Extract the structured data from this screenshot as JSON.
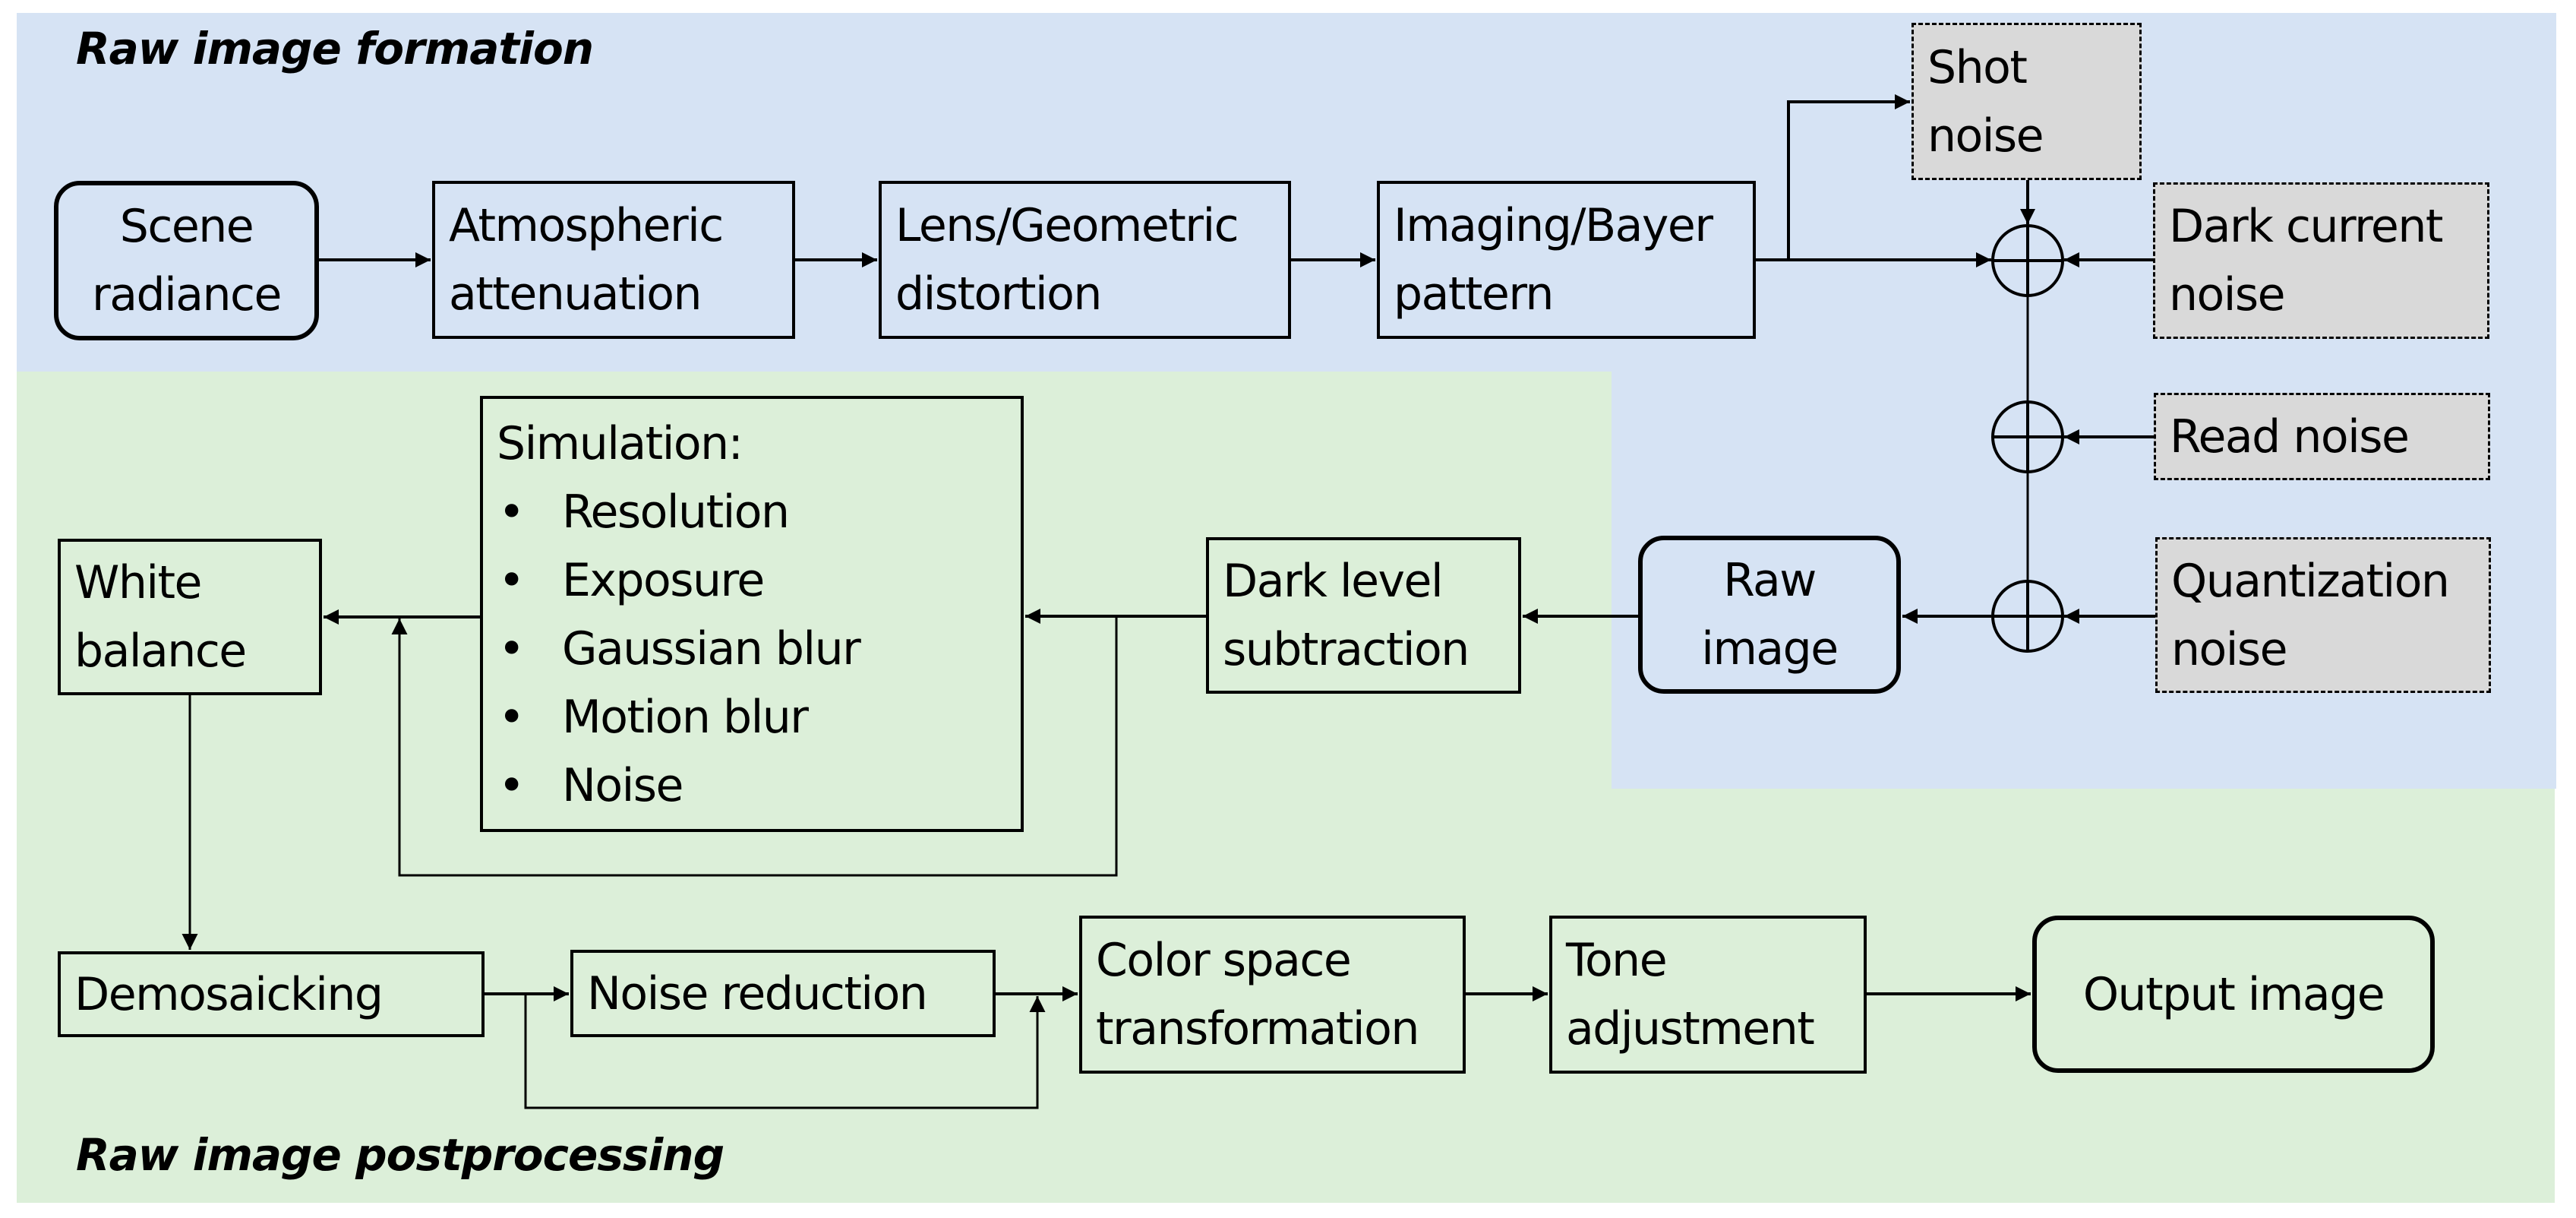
{
  "sections": {
    "formation_title": "Raw image formation",
    "postprocessing_title": "Raw image postprocessing"
  },
  "colors": {
    "formation_panel": "#d6e3f4",
    "postprocessing_panel": "#dcefd9",
    "noise_box": "#d9d9d9",
    "stroke": "#000000"
  },
  "formation": {
    "scene_radiance": [
      "Scene",
      "radiance"
    ],
    "atmospheric": [
      "Atmospheric",
      "attenuation"
    ],
    "lens": [
      "Lens/Geometric",
      "distortion"
    ],
    "imaging": [
      "Imaging/Bayer",
      "pattern"
    ],
    "shot_noise": [
      "Shot",
      "noise"
    ],
    "dark_current_noise": [
      "Dark current",
      "noise"
    ],
    "read_noise": [
      "Read noise"
    ],
    "quantization_noise": [
      "Quantization",
      "noise"
    ],
    "raw_image": [
      "Raw",
      "image"
    ],
    "adder_symbol": "⊕"
  },
  "postprocessing": {
    "dark_level": [
      "Dark level",
      "subtraction"
    ],
    "simulation": {
      "heading": "Simulation:",
      "items": [
        "Resolution",
        "Exposure",
        "Gaussian blur",
        "Motion blur",
        "Noise"
      ]
    },
    "white_balance": [
      "White",
      "balance"
    ],
    "demosaicking": [
      "Demosaicking"
    ],
    "noise_reduction": [
      "Noise reduction"
    ],
    "color_space": [
      "Color space",
      "transformation"
    ],
    "tone": [
      "Tone",
      "adjustment"
    ],
    "output_image": [
      "Output image"
    ]
  }
}
